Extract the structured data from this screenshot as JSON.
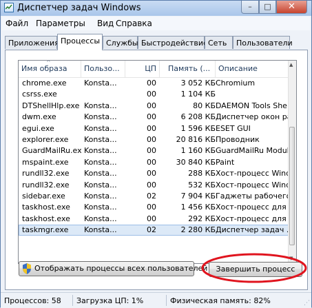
{
  "window": {
    "title": "Диспетчер задач Windows",
    "close_glyph": "✕",
    "min_glyph": "–",
    "max_glyph": "□"
  },
  "menu": [
    "Файл",
    "Параметры",
    "Вид",
    "Справка"
  ],
  "tabs": [
    {
      "label": "Приложения",
      "active": false
    },
    {
      "label": "Процессы",
      "active": true
    },
    {
      "label": "Службы",
      "active": false
    },
    {
      "label": "Быстродействие",
      "active": false
    },
    {
      "label": "Сеть",
      "active": false
    },
    {
      "label": "Пользователи",
      "active": false
    }
  ],
  "columns": {
    "name": "Имя образа",
    "user": "Пользо...",
    "cpu": "ЦП",
    "memory": "Память (...",
    "description": "Описание",
    "sort_glyph": "^"
  },
  "processes": [
    {
      "name": "chrome.exe",
      "user": "Konsta...",
      "cpu": "00",
      "memory": "3 052 КБ",
      "description": "Chromium"
    },
    {
      "name": "csrss.exe",
      "user": "",
      "cpu": "00",
      "memory": "1 104 КБ",
      "description": ""
    },
    {
      "name": "DTShellHlp.exe",
      "user": "Konsta...",
      "cpu": "00",
      "memory": "80 КБ",
      "description": "DAEMON Tools Shell..."
    },
    {
      "name": "dwm.exe",
      "user": "Konsta...",
      "cpu": "00",
      "memory": "6 208 КБ",
      "description": "Диспетчер окон ра..."
    },
    {
      "name": "egui.exe",
      "user": "Konsta...",
      "cpu": "00",
      "memory": "1 596 КБ",
      "description": "ESET GUI"
    },
    {
      "name": "explorer.exe",
      "user": "Konsta...",
      "cpu": "00",
      "memory": "20 816 КБ",
      "description": "Проводник"
    },
    {
      "name": "GuardMailRu.exe",
      "user": "Konsta...",
      "cpu": "00",
      "memory": "1 160 КБ",
      "description": "GuardMailRu Module"
    },
    {
      "name": "mspaint.exe",
      "user": "Konsta...",
      "cpu": "00",
      "memory": "30 840 КБ",
      "description": "Paint"
    },
    {
      "name": "rundll32.exe",
      "user": "Konsta...",
      "cpu": "00",
      "memory": "288 КБ",
      "description": "Хост-процесс Wind..."
    },
    {
      "name": "rundll32.exe",
      "user": "Konsta...",
      "cpu": "00",
      "memory": "532 КБ",
      "description": "Хост-процесс Wind..."
    },
    {
      "name": "sidebar.exe",
      "user": "Konsta...",
      "cpu": "02",
      "memory": "7 904 КБ",
      "description": "Гаджеты рабочего ..."
    },
    {
      "name": "taskhost.exe",
      "user": "Konsta...",
      "cpu": "00",
      "memory": "1 456 КБ",
      "description": "Хост-процесс для з..."
    },
    {
      "name": "taskhost.exe",
      "user": "Konsta...",
      "cpu": "00",
      "memory": "292 КБ",
      "description": "Хост-процесс для з..."
    },
    {
      "name": "taskmgr.exe",
      "user": "Konsta...",
      "cpu": "02",
      "memory": "2 280 КБ",
      "description": "Диспетчер задач ..."
    }
  ],
  "selected_row": 13,
  "buttons": {
    "show_all": "Отображать процессы всех пользователей",
    "end_process": "Завершить процесс"
  },
  "status": {
    "processes": "Процессов: 58",
    "cpu": "Загрузка ЦП: 1%",
    "memory": "Физическая память: 82%"
  },
  "colors": {
    "highlight_ellipse": "#e0141e",
    "selection": "#dce9f7"
  }
}
